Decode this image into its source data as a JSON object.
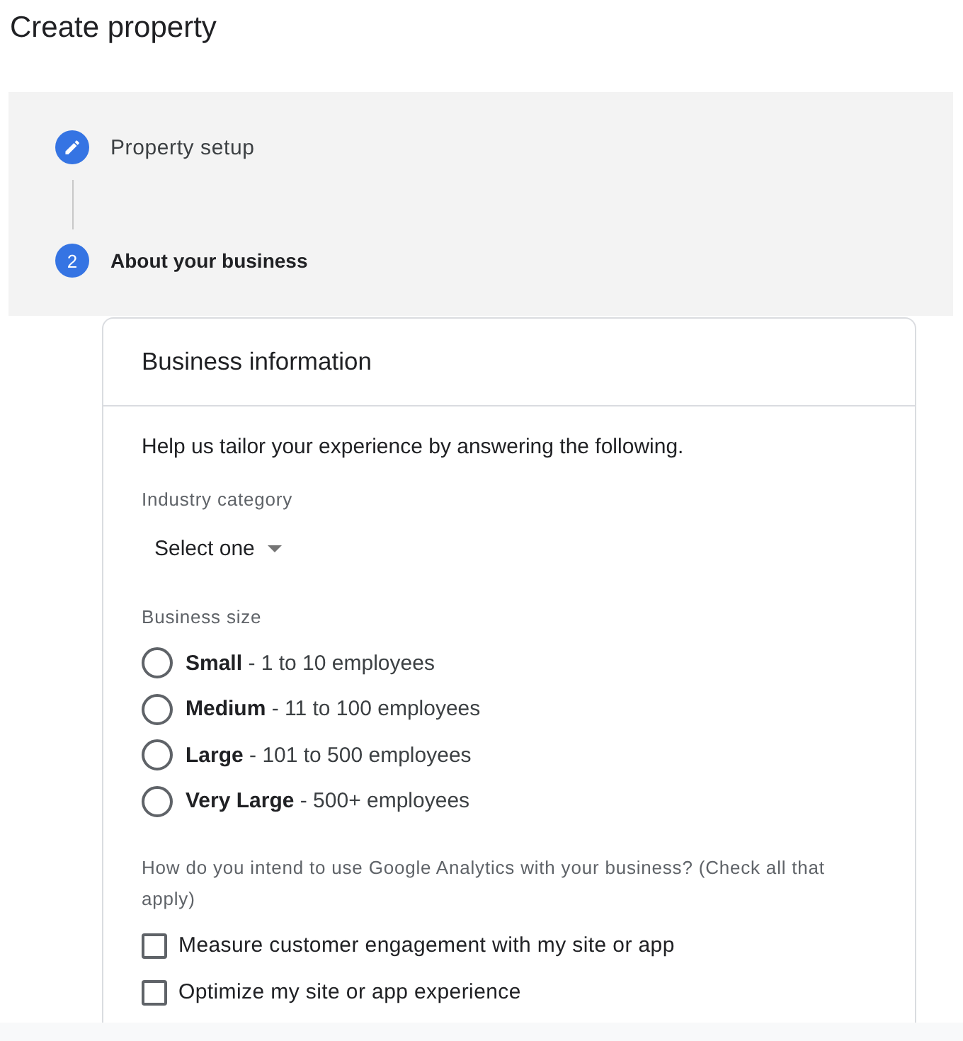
{
  "page": {
    "title": "Create property"
  },
  "stepper": {
    "steps": [
      {
        "kind": "edit",
        "label": "Property setup",
        "active": false
      },
      {
        "kind": "number",
        "number": "2",
        "label": "About your business",
        "active": true
      }
    ]
  },
  "card": {
    "title": "Business information",
    "intro": "Help us tailor your experience by answering the following.",
    "industry": {
      "label": "Industry category",
      "value": "Select one"
    },
    "size": {
      "label": "Business size",
      "options": [
        {
          "text": "**Small** - 1 to 10 employees",
          "selected": false
        },
        {
          "text": "**Medium** - 11 to 100 employees",
          "selected": false
        },
        {
          "text": "**Large** - 101 to 500 employees",
          "selected": false
        },
        {
          "text": "**Very Large** - 500+ employees",
          "selected": false
        }
      ]
    },
    "usage": {
      "question": "How do you intend to use Google Analytics with your business? (Check all that apply)",
      "options": [
        {
          "label": "Measure customer engagement with my site or app",
          "checked": false
        },
        {
          "label": "Optimize my site or app experience",
          "checked": false
        }
      ]
    }
  }
}
